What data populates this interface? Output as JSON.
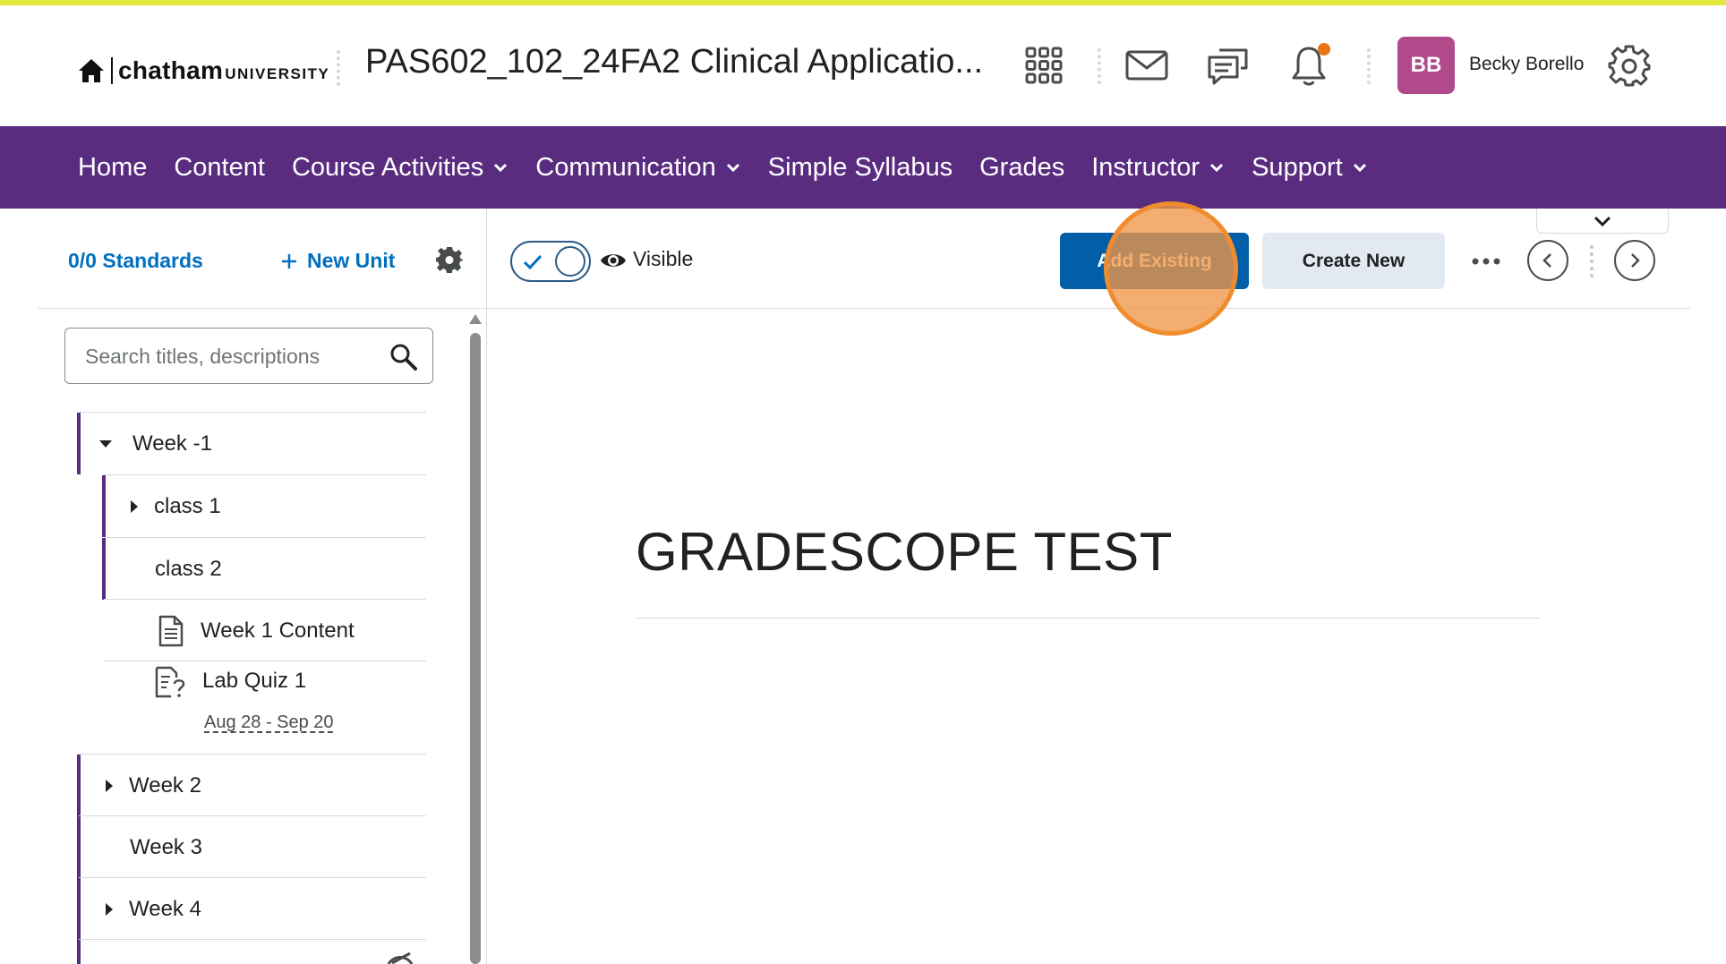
{
  "header": {
    "logo_text": "chatham",
    "logo_small": "UNIVERSITY",
    "course_title": "PAS602_102_24FA2 Clinical Applicatio...",
    "user_initials": "BB",
    "user_name": "Becky Borello",
    "icons": [
      "waffle-icon",
      "mail-icon",
      "chat-icon",
      "bell-icon",
      "gear-icon"
    ],
    "accent_colors": {
      "avatar": "#b04a8b",
      "notification": "#e87511"
    }
  },
  "nav": {
    "items": [
      {
        "label": "Home",
        "dropdown": false
      },
      {
        "label": "Content",
        "dropdown": false
      },
      {
        "label": "Course Activities",
        "dropdown": true
      },
      {
        "label": "Communication",
        "dropdown": true
      },
      {
        "label": "Simple Syllabus",
        "dropdown": false
      },
      {
        "label": "Grades",
        "dropdown": false
      },
      {
        "label": "Instructor",
        "dropdown": true
      },
      {
        "label": "Support",
        "dropdown": true
      }
    ],
    "bar_color": "#5a2c80"
  },
  "sidebar": {
    "standards_label": "0/0 Standards",
    "new_unit_label": "New Unit",
    "search_placeholder": "Search titles, descriptions",
    "tree": [
      {
        "label": "Week -1"
      },
      {
        "label": "class 1"
      },
      {
        "label": "class 2"
      },
      {
        "label": "Week 1 Content"
      },
      {
        "label": "Lab Quiz 1",
        "dates": "Aug 28 - Sep 20"
      },
      {
        "label": "Week 2"
      },
      {
        "label": "Week 3"
      },
      {
        "label": "Week 4"
      }
    ]
  },
  "toolbar": {
    "visibility_label": "Visible",
    "visibility_on": true,
    "add_existing_label": "Add Existing",
    "create_new_label": "Create New",
    "primary_color": "#005fa8"
  },
  "main": {
    "title": "GRADESCOPE TEST"
  }
}
